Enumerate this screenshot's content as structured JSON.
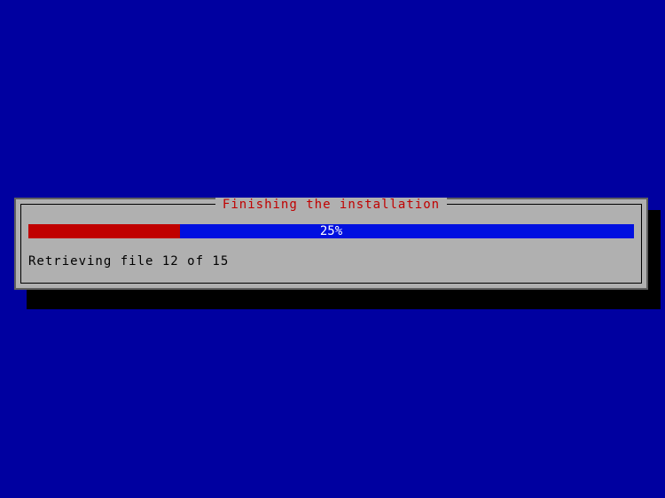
{
  "dialog": {
    "title": "Finishing the installation",
    "progress_percent": 25,
    "progress_label": "25%",
    "status_text": "Retrieving file 12 of 15"
  }
}
